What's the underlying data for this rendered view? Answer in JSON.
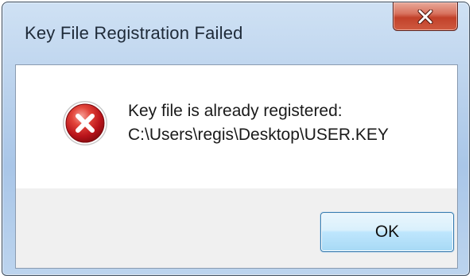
{
  "window": {
    "title": "Key File Registration Failed",
    "close_icon": "close-x-icon"
  },
  "dialog": {
    "icon": "error-icon",
    "message_line1": "Key file is already registered:",
    "message_line2": "C:\\Users\\regis\\Desktop\\USER.KEY",
    "ok_label": "OK"
  },
  "colors": {
    "titlebar": "#b9d1ec",
    "close_button": "#c2412a",
    "error_icon": "#c4161c",
    "ok_button": "#bee6fd",
    "client_background": "#f0f0f0"
  }
}
